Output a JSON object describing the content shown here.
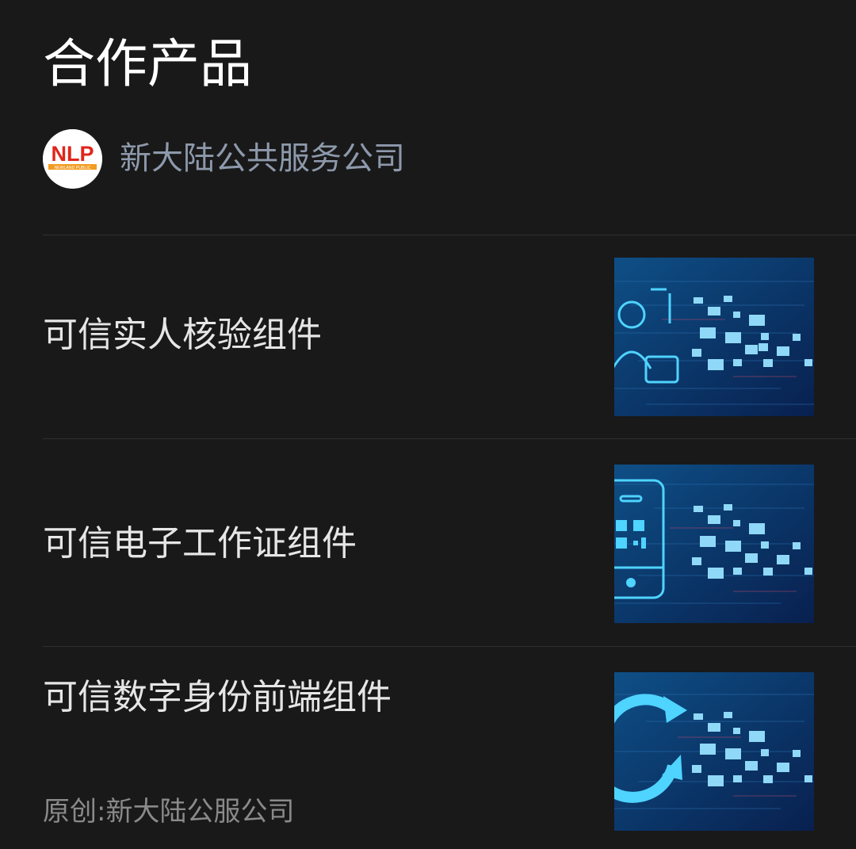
{
  "section": {
    "title": "合作产品"
  },
  "publisher": {
    "logo_text": "NLP",
    "logo_subtext": "NEWLAND PUBLIC",
    "name": "新大陆公共服务公司"
  },
  "products": [
    {
      "title": "可信实人核验组件",
      "thumbnail_icon": "person-headset-icon"
    },
    {
      "title": "可信电子工作证组件",
      "thumbnail_icon": "qr-phone-icon"
    },
    {
      "title": "可信数字身份前端组件",
      "thumbnail_icon": "refresh-arrows-icon",
      "source": "原创:新大陆公服公司"
    }
  ],
  "colors": {
    "background": "#191919",
    "publisher_name": "#8d99ab",
    "thumbnail_accent": "#4fd3ff"
  }
}
